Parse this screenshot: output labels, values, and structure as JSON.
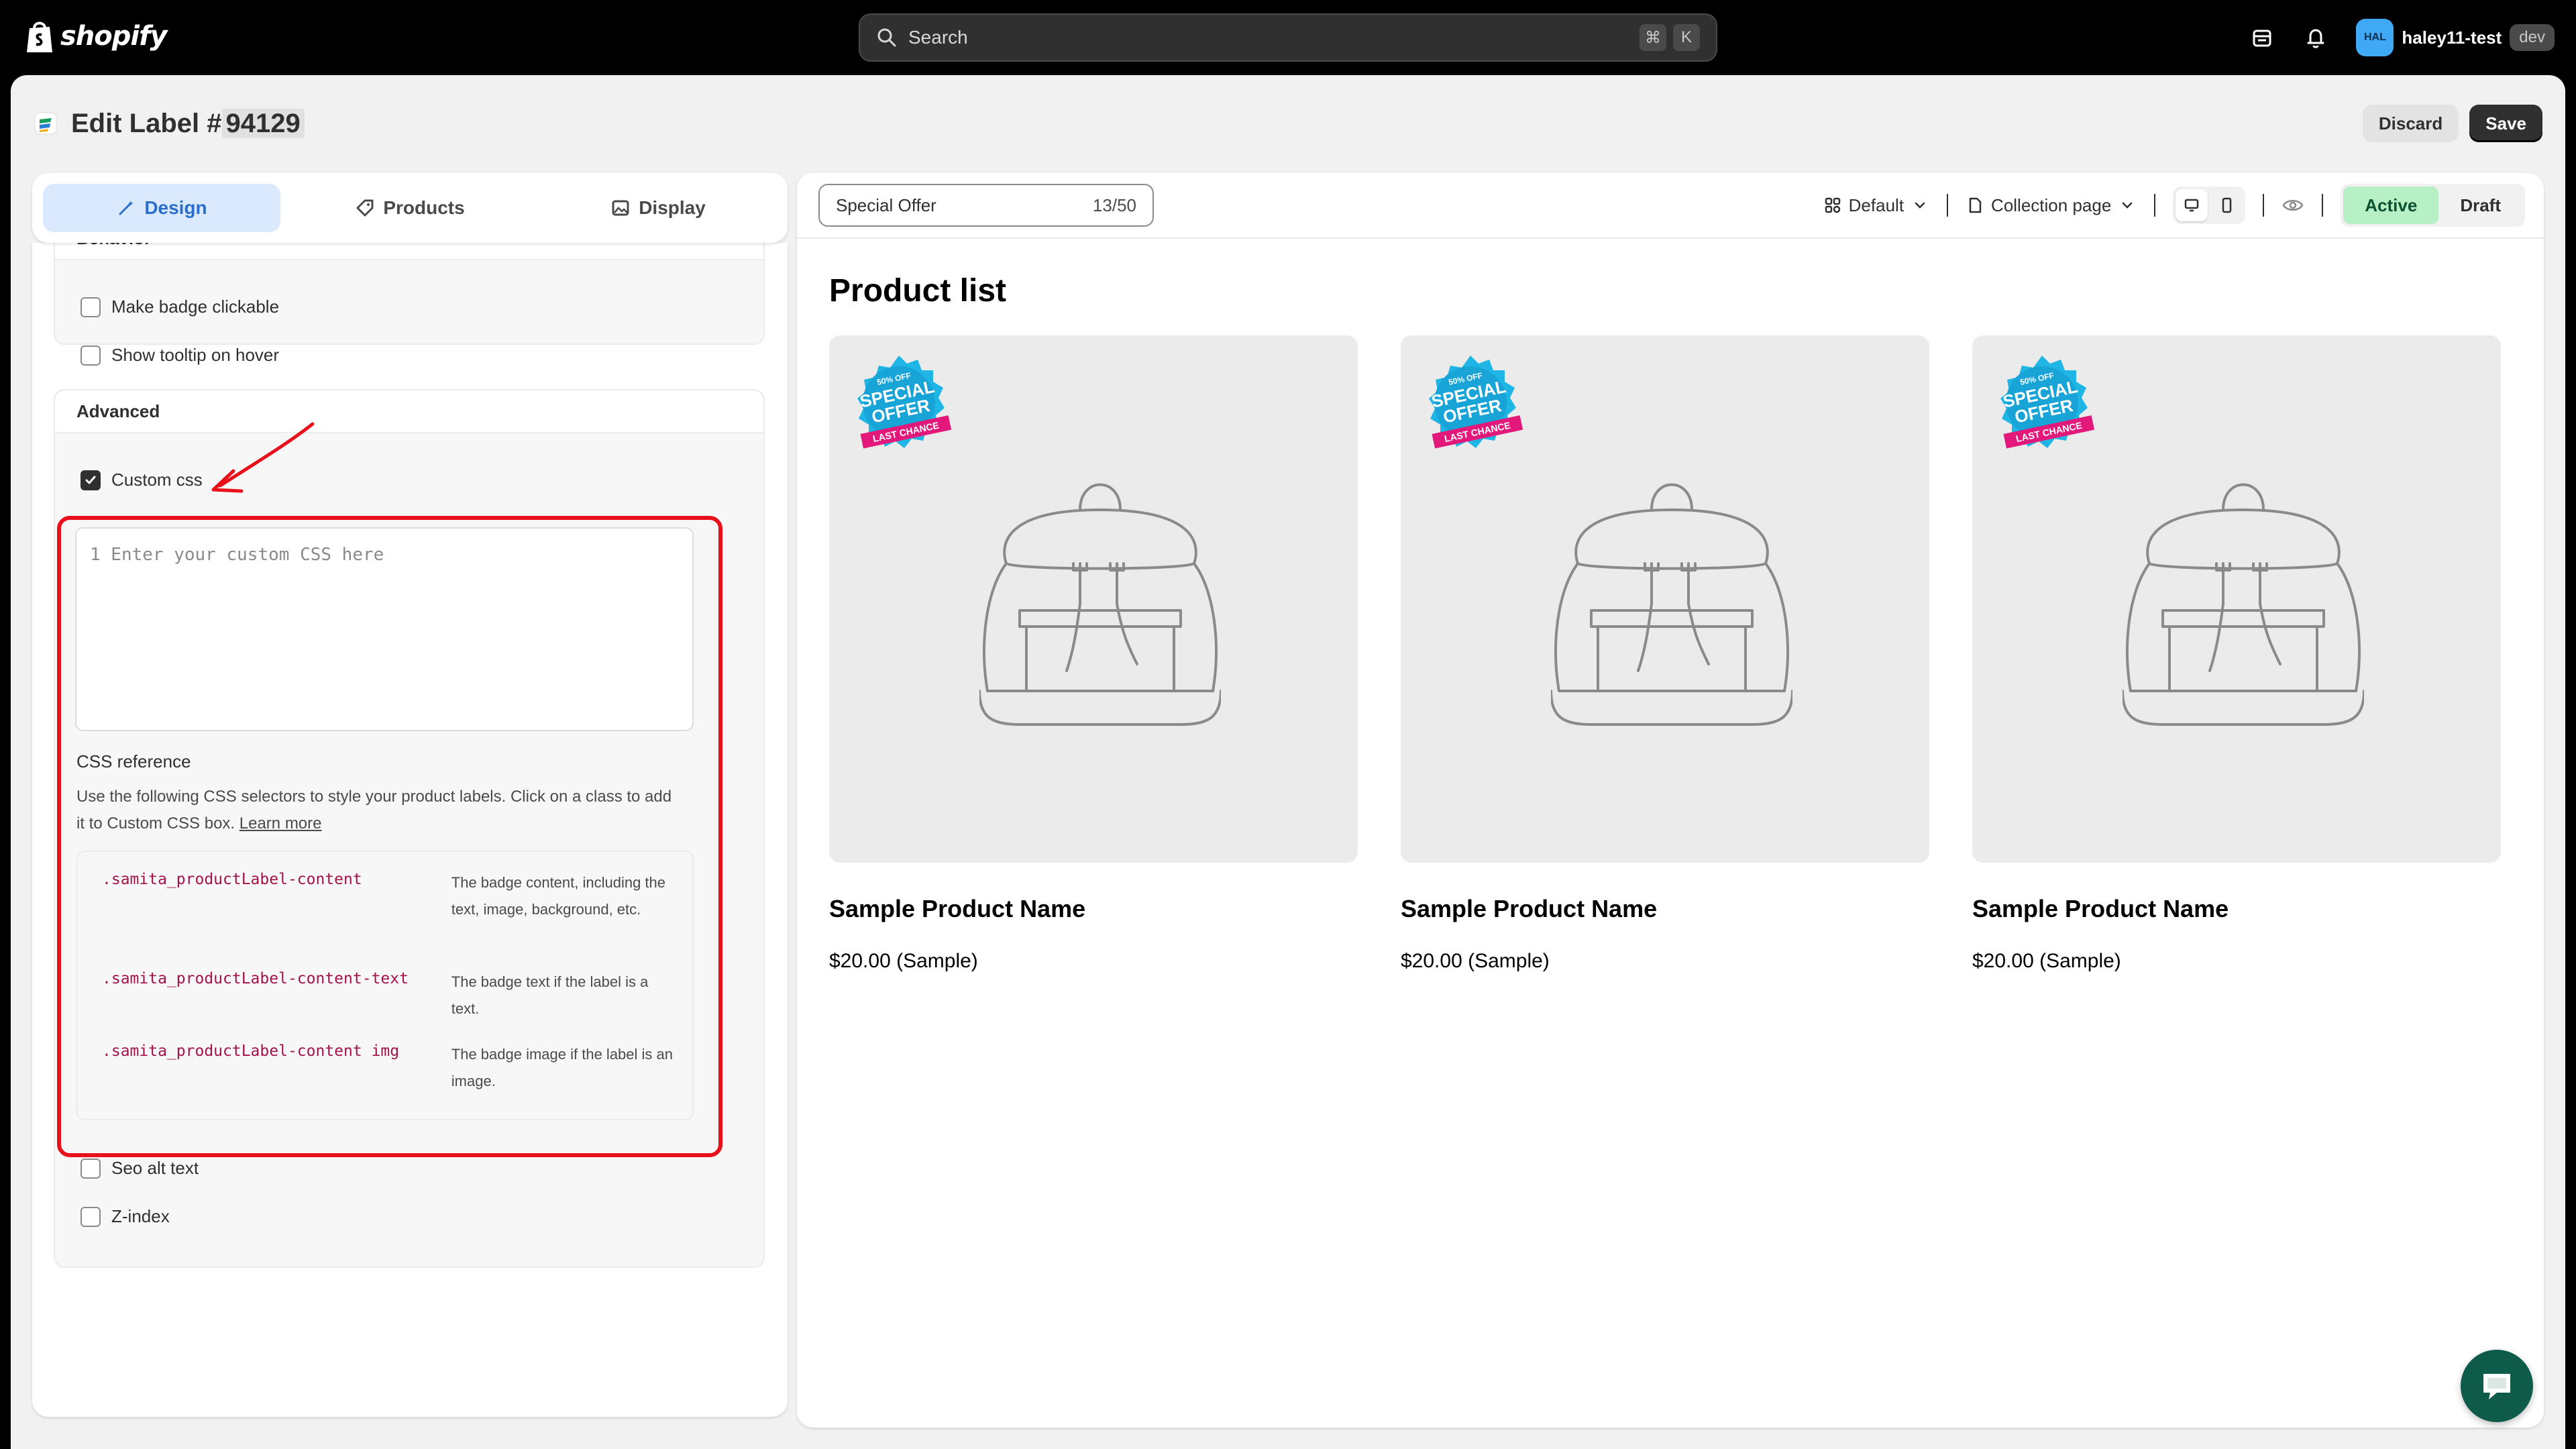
{
  "topbar": {
    "brand": "shopify",
    "search_placeholder": "Search",
    "shortcut_keys": [
      "⌘",
      "K"
    ],
    "avatar_initials": "HAL",
    "account_name": "haley11-test",
    "account_badge": "dev"
  },
  "header": {
    "title_prefix": "Edit Label #",
    "title_id": "94129",
    "discard_label": "Discard",
    "save_label": "Save"
  },
  "tabs": [
    {
      "label": "Design",
      "active": true
    },
    {
      "label": "Products",
      "active": false
    },
    {
      "label": "Display",
      "active": false
    }
  ],
  "behavior": {
    "title": "Behavior",
    "options": [
      {
        "label": "Make badge clickable",
        "checked": false
      },
      {
        "label": "Show tooltip on hover",
        "checked": false
      }
    ]
  },
  "advanced": {
    "title": "Advanced",
    "custom_css": {
      "label": "Custom css",
      "checked": true
    },
    "editor_placeholder": "1  Enter your custom CSS here",
    "reference_title": "CSS reference",
    "reference_desc": "Use the following CSS selectors to style your product labels. Click on a class to add it to Custom CSS box.",
    "learn_more": "Learn more",
    "selectors": [
      {
        "selector": ".samita_productLabel-content",
        "desc": "The badge content, including the text, image, background, etc."
      },
      {
        "selector": ".samita_productLabel-content-text",
        "desc": "The badge text if the label is a text."
      },
      {
        "selector": ".samita_productLabel-content img",
        "desc": "The badge image if the label is an image."
      }
    ],
    "options": [
      {
        "label": "Seo alt text",
        "checked": false
      },
      {
        "label": "Z-index",
        "checked": false
      }
    ]
  },
  "preview": {
    "label_name": "Special Offer",
    "label_count": "13/50",
    "template_dropdown": "Default",
    "page_dropdown": "Collection page",
    "status_active": "Active",
    "status_draft": "Draft",
    "list_title": "Product list",
    "badge": {
      "top": "50% OFF",
      "main1": "SPECIAL",
      "main2": "OFFER",
      "ribbon": "LAST CHANCE"
    },
    "products": [
      {
        "name": "Sample Product Name",
        "price": "$20.00 (Sample)"
      },
      {
        "name": "Sample Product Name",
        "price": "$20.00 (Sample)"
      },
      {
        "name": "Sample Product Name",
        "price": "$20.00 (Sample)"
      }
    ]
  },
  "colors": {
    "accent_blue": "#2c6ecb",
    "active_green": "#b7f0c4",
    "annotation_red": "#e8101a",
    "selector_pink": "#a3134a"
  }
}
